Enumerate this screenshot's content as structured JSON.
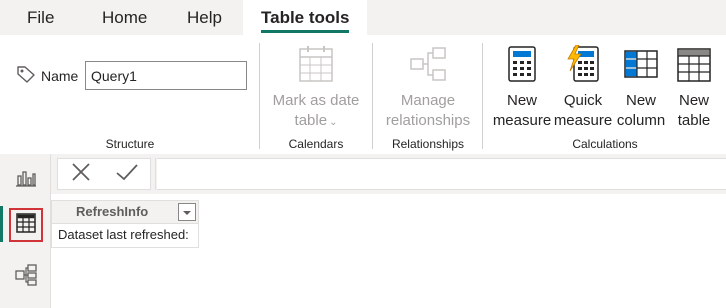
{
  "menu": {
    "tabs": [
      {
        "label": "File"
      },
      {
        "label": "Home"
      },
      {
        "label": "Help"
      },
      {
        "label": "Table tools"
      }
    ]
  },
  "ribbon": {
    "structure": {
      "name_label": "Name",
      "name_value": "Query1",
      "title": "Structure"
    },
    "calendars": {
      "mark_as_date_line1": "Mark as date",
      "mark_as_date_line2": "table",
      "title": "Calendars"
    },
    "relationships": {
      "manage_line1": "Manage",
      "manage_line2": "relationships",
      "title": "Relationships"
    },
    "calculations": {
      "new_measure_line1": "New",
      "new_measure_line2": "measure",
      "quick_measure_line1": "Quick",
      "quick_measure_line2": "measure",
      "new_column_line1": "New",
      "new_column_line2": "column",
      "new_table_line1": "New",
      "new_table_line2": "table",
      "title": "Calculations"
    }
  },
  "grid": {
    "column_header": "RefreshInfo",
    "cell_value": "Dataset last refreshed:"
  },
  "colors": {
    "accent": "#117865",
    "highlight_border": "#d13438",
    "disabled_text": "#a19f9d"
  }
}
